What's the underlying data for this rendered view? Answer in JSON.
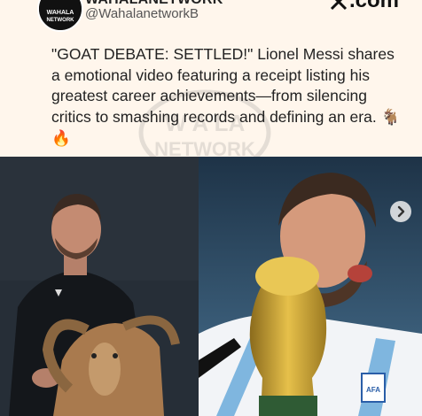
{
  "header": {
    "account_name": "WAHALANETWORK",
    "handle": "@WahalanetworkB",
    "site": ".com",
    "avatar_text": "WAHALA\nNETWORK"
  },
  "post": {
    "text": "\"GOAT DEBATE: SETTLED!\" Lionel Messi shares a emotional video featuring a receipt listing his greatest career achievements—from silencing critics to smashing records and defining an era.",
    "emoji_goat": "🐐",
    "emoji_fire": "🔥"
  },
  "watermark": {
    "line1": "WAHALA",
    "line2": "NETWORK"
  },
  "images": {
    "left": "messi-with-goat-photo",
    "right": "messi-with-world-cup-photo"
  },
  "carousel": {
    "next_icon": "chevron-right-icon"
  },
  "colors": {
    "background": "#fff6ec",
    "text": "#222222",
    "handle": "#555555"
  }
}
